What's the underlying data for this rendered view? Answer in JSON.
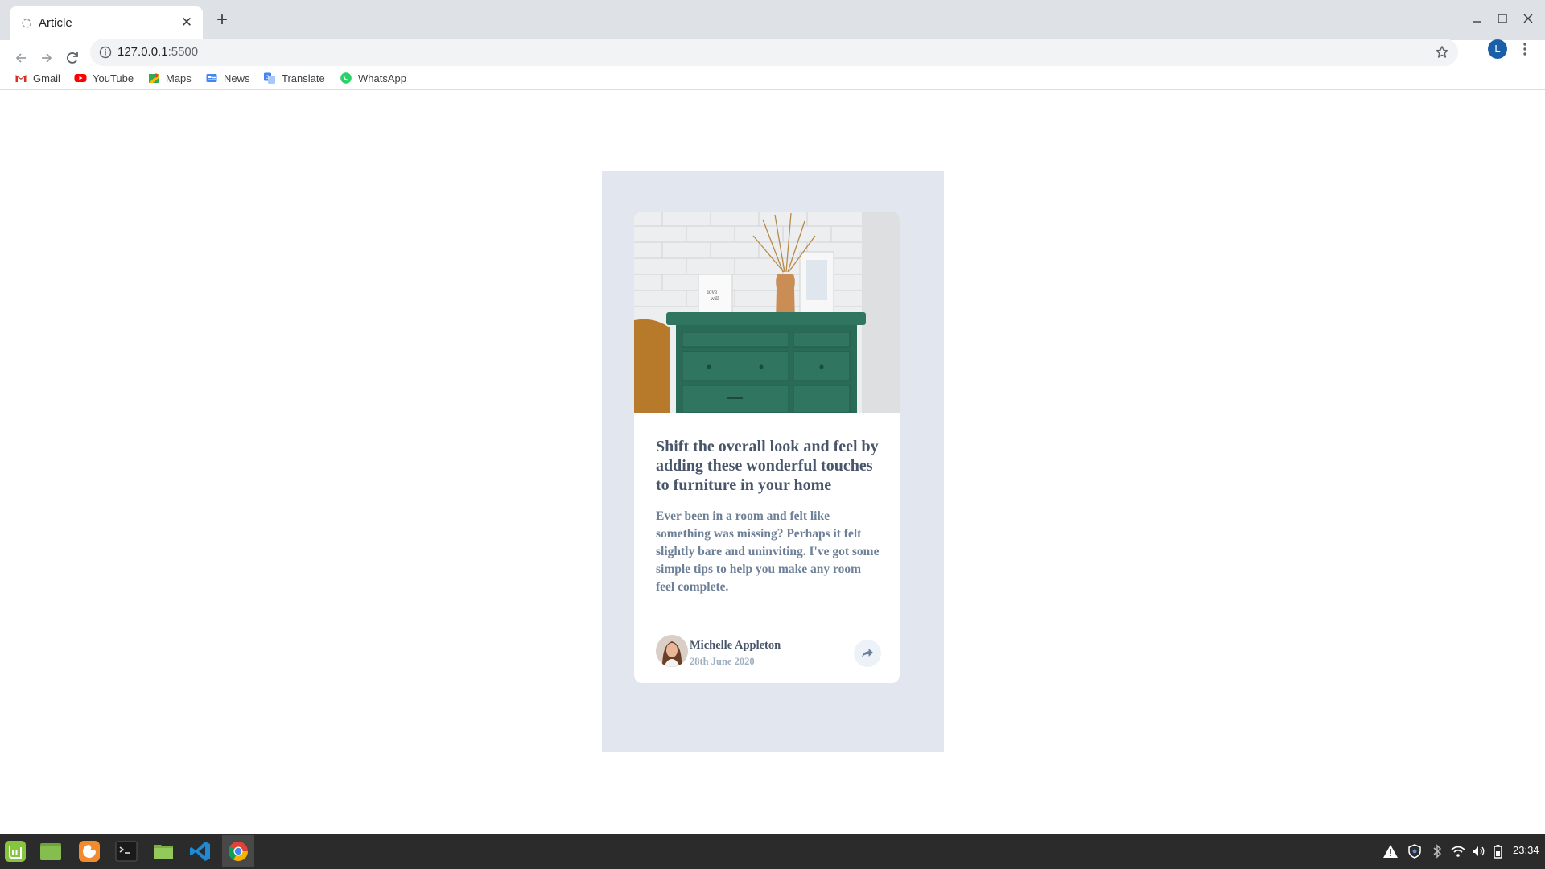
{
  "browser": {
    "tab_title": "Article",
    "tab_close": "✕",
    "new_tab": "+",
    "url_host": "127.0.0.1",
    "url_port": ":5500",
    "profile_initial": "L",
    "bookmarks": [
      {
        "label": "Gmail",
        "icon": "gmail-icon"
      },
      {
        "label": "YouTube",
        "icon": "youtube-icon"
      },
      {
        "label": "Maps",
        "icon": "maps-icon"
      },
      {
        "label": "News",
        "icon": "news-icon"
      },
      {
        "label": "Translate",
        "icon": "translate-icon"
      },
      {
        "label": "WhatsApp",
        "icon": "whatsapp-icon"
      }
    ]
  },
  "article": {
    "headline": "Shift the overall look and feel by adding these wonderful touches to furniture in your home",
    "excerpt": "Ever been in a room and felt like something was missing? Perhaps it felt slightly bare and uninviting. I've got some simple tips to help you make any room feel complete.",
    "author_name": "Michelle Appleton",
    "date": "28th June 2020",
    "share_icon": "share-arrow-icon"
  },
  "colors": {
    "panel_bg": "#e2e7ef",
    "heading": "#48556a",
    "body_text": "#6e8098",
    "muted": "#9eafc2"
  },
  "taskbar": {
    "apps": [
      "mint-menu-icon",
      "files-green-icon",
      "firefox-icon",
      "terminal-icon",
      "folder-icon",
      "vscode-icon",
      "chrome-icon"
    ],
    "clock": "23:34"
  }
}
